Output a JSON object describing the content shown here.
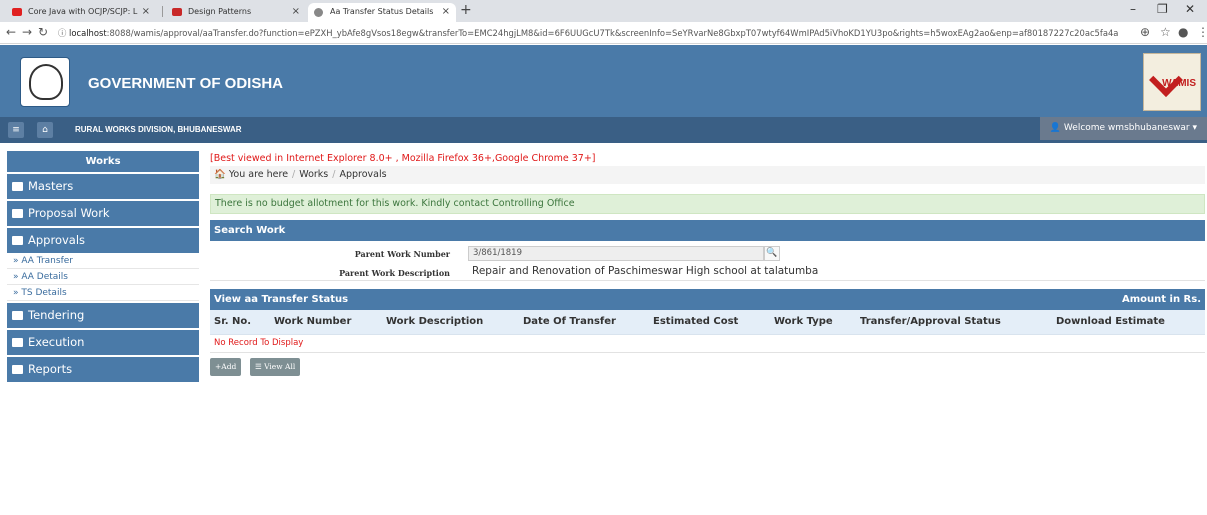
{
  "browser": {
    "tabs": [
      {
        "label": "Core Java with OCJP/SCJP: L"
      },
      {
        "label": "Design Patterns"
      },
      {
        "label": "Aa Transfer Status Details"
      }
    ],
    "url_host": "localhost",
    "url_rest": ":8088/wamis/approval/aaTransfer.do?function=ePZXH_ybAfe8gVsos18egw&transferTo=EMC24hgjLM8&id=6F6UUGcU7Tk&screenInfo=SeYRvarNe8GbxpT07wtyf64WmIPAd5iVhoKD1YU3po&rights=h5woxEAg2ao&enp=af80187227c20ac5fa4a7ad225cac..."
  },
  "header": {
    "title": "GOVERNMENT OF ODISHA",
    "logo_text": "WAMIS"
  },
  "navbar": {
    "division": "RURAL WORKS DIVISION, BHUBANESWAR",
    "welcome": "Welcome wmsbhubaneswar"
  },
  "sidebar": {
    "heading": "Works",
    "items": [
      {
        "label": "Masters"
      },
      {
        "label": "Proposal Work"
      },
      {
        "label": "Approvals"
      },
      {
        "label": "Tendering"
      },
      {
        "label": "Execution"
      },
      {
        "label": "Reports"
      }
    ],
    "sub_items": [
      {
        "label": "» AA Transfer"
      },
      {
        "label": "» AA Details"
      },
      {
        "label": "» TS Details"
      }
    ]
  },
  "main": {
    "best_viewed": "[Best viewed in Internet Explorer 8.0+ , Mozilla Firefox 36+,Google Chrome 37+]",
    "breadcrumb": [
      "You are here",
      "Works",
      "Approvals"
    ],
    "alert": "There is no budget allotment for this work. Kindly contact Controlling Office",
    "search_panel": {
      "title": "Search Work",
      "parent_number_label": "Parent Work Number",
      "parent_number_value": "3/861/1819",
      "parent_desc_label": "Parent Work Description",
      "parent_desc_value": "Repair and Renovation of Paschimeswar High school at talatumba"
    },
    "status_panel": {
      "title": "View aa Transfer Status",
      "amount_note": "Amount in Rs.",
      "columns": [
        "Sr. No.",
        "Work Number",
        "Work Description",
        "Date Of Transfer",
        "Estimated Cost",
        "Work Type",
        "Transfer/Approval Status",
        "Download Estimate"
      ],
      "empty_message": "No Record To Display"
    },
    "buttons": {
      "add": "Add",
      "view_all": "View All"
    }
  }
}
